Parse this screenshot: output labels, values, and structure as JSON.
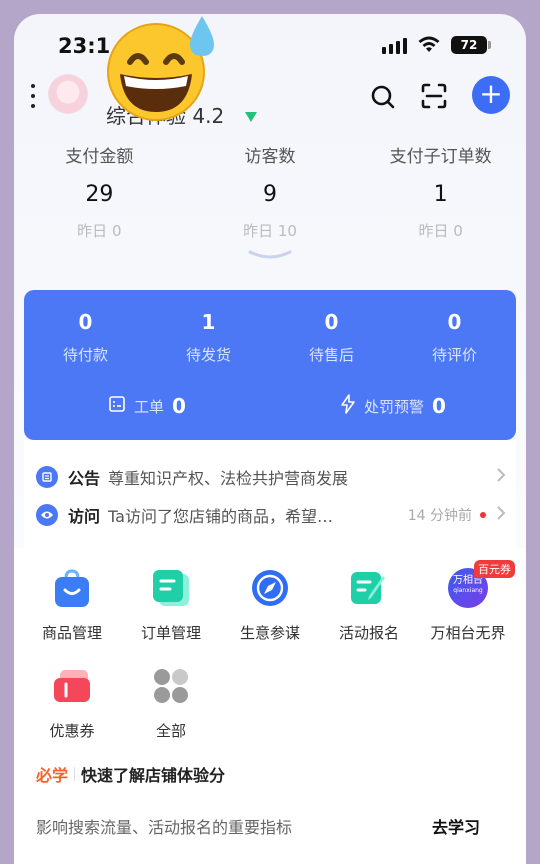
{
  "status_bar": {
    "time": "23:1",
    "battery": "72"
  },
  "header": {
    "score_label": "综合体验 4.2",
    "trend_icon": "down-triangle-icon",
    "accent": "#3d6cf5",
    "add_symbol": "+"
  },
  "stats": [
    {
      "label": "支付金额",
      "value": "29",
      "prev": "昨日 0"
    },
    {
      "label": "访客数",
      "value": "9",
      "prev": "昨日 10"
    },
    {
      "label": "支付子订单数",
      "value": "1",
      "prev": "昨日 0"
    }
  ],
  "orders": {
    "items": [
      {
        "count": "0",
        "label": "待付款"
      },
      {
        "count": "1",
        "label": "待发货"
      },
      {
        "count": "0",
        "label": "待售后"
      },
      {
        "count": "0",
        "label": "待评价"
      }
    ],
    "ticket": {
      "label": "工单",
      "count": "0"
    },
    "penalty": {
      "label": "处罚预警",
      "count": "0"
    },
    "color": "#4d78f5"
  },
  "notices": [
    {
      "title": "公告",
      "text": "尊重知识产权、法检共护营商发展",
      "time": ""
    },
    {
      "title": "访问",
      "text": "Ta访问了您店铺的商品，希望…",
      "time": "14 分钟前"
    }
  ],
  "tools": [
    {
      "label": "商品管理",
      "icon": "shopping-bag-icon"
    },
    {
      "label": "订单管理",
      "icon": "order-doc-icon"
    },
    {
      "label": "生意参谋",
      "icon": "compass-icon"
    },
    {
      "label": "活动报名",
      "icon": "edit-doc-icon"
    },
    {
      "label": "万相台无界",
      "icon": "wanxiangtai-icon",
      "badge": "百元券",
      "logo_text": "万相台",
      "logo_sub": "qianxiang"
    },
    {
      "label": "优惠券",
      "icon": "coupon-icon"
    },
    {
      "label": "全部",
      "icon": "all-grid-icon"
    }
  ],
  "learn": {
    "tag": "必学",
    "title": "快速了解店铺体验分",
    "desc": "影响搜索流量、活动报名的重要指标",
    "button": "去学习"
  }
}
